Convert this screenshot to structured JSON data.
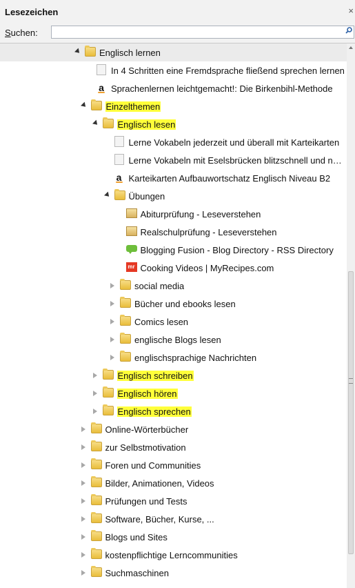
{
  "panel": {
    "title": "Lesezeichen",
    "close": "×"
  },
  "search": {
    "label_prefix": "S",
    "label_rest": "uchen:",
    "value": "",
    "placeholder": ""
  },
  "items": [
    {
      "label": "Englisch lernen",
      "icon": "folder-icon",
      "depth": 0,
      "expand": "open",
      "selected": true,
      "highlight": false
    },
    {
      "label": "In 4 Schritten eine Fremdsprache fließend sprechen lernen",
      "icon": "page-icon",
      "depth": 1,
      "expand": "none",
      "highlight": false
    },
    {
      "label": "Sprachenlernen leichtgemacht!: Die Birkenbihl-Methode",
      "icon": "amazon-icon",
      "depth": 1,
      "expand": "none",
      "highlight": false
    },
    {
      "label": "Einzelthemen",
      "icon": "folder-icon",
      "depth": 0.5,
      "expand": "open",
      "highlight": true
    },
    {
      "label": "Englisch lesen",
      "icon": "folder-icon",
      "depth": 1.5,
      "expand": "open",
      "highlight": true
    },
    {
      "label": "Lerne Vokabeln jederzeit und überall mit Karteikarten",
      "icon": "page-icon",
      "depth": 2.5,
      "expand": "none",
      "highlight": false
    },
    {
      "label": "Lerne Vokabeln mit Eselsbrücken blitzschnell und nachhaltig",
      "icon": "page-icon",
      "depth": 2.5,
      "expand": "none",
      "highlight": false
    },
    {
      "label": "Karteikarten Aufbauwortschatz Englisch Niveau B2",
      "icon": "amazon-icon",
      "depth": 2.5,
      "expand": "none",
      "highlight": false
    },
    {
      "label": "Übungen",
      "icon": "folder-icon",
      "depth": 2.5,
      "expand": "open",
      "highlight": false
    },
    {
      "label": "Abiturprüfung  - Leseverstehen",
      "icon": "certificate-icon",
      "depth": 3.5,
      "expand": "none",
      "highlight": false
    },
    {
      "label": "Realschulprüfung - Leseverstehen",
      "icon": "certificate-icon",
      "depth": 3.5,
      "expand": "none",
      "highlight": false
    },
    {
      "label": "Blogging Fusion - Blog Directory - RSS Directory",
      "icon": "chat-icon",
      "depth": 3.5,
      "expand": "none",
      "highlight": false
    },
    {
      "label": "Cooking Videos | MyRecipes.com",
      "icon": "myrecipes-icon",
      "depth": 3.5,
      "expand": "none",
      "highlight": false
    },
    {
      "label": "social media",
      "icon": "folder-icon",
      "depth": 3,
      "expand": "closed",
      "highlight": false
    },
    {
      "label": "Bücher und ebooks lesen",
      "icon": "folder-icon",
      "depth": 3,
      "expand": "closed",
      "highlight": false
    },
    {
      "label": "Comics lesen",
      "icon": "folder-icon",
      "depth": 3,
      "expand": "closed",
      "highlight": false
    },
    {
      "label": "englische Blogs lesen",
      "icon": "folder-icon",
      "depth": 3,
      "expand": "closed",
      "highlight": false
    },
    {
      "label": "englischsprachige Nachrichten",
      "icon": "folder-icon",
      "depth": 3,
      "expand": "closed",
      "highlight": false
    },
    {
      "label": "Englisch schreiben",
      "icon": "folder-icon",
      "depth": 1.5,
      "expand": "closed",
      "highlight": true
    },
    {
      "label": "Englisch hören",
      "icon": "folder-icon",
      "depth": 1.5,
      "expand": "closed",
      "highlight": true
    },
    {
      "label": "Englisch sprechen",
      "icon": "folder-icon",
      "depth": 1.5,
      "expand": "closed",
      "highlight": true
    },
    {
      "label": "Online-Wörterbücher",
      "icon": "folder-icon",
      "depth": 0.5,
      "expand": "closed",
      "highlight": false
    },
    {
      "label": "zur Selbstmotivation",
      "icon": "folder-icon",
      "depth": 0.5,
      "expand": "closed",
      "highlight": false
    },
    {
      "label": "Foren und Communities",
      "icon": "folder-icon",
      "depth": 0.5,
      "expand": "closed",
      "highlight": false
    },
    {
      "label": "Bilder, Animationen, Videos",
      "icon": "folder-icon",
      "depth": 0.5,
      "expand": "closed",
      "highlight": false
    },
    {
      "label": "Prüfungen und Tests",
      "icon": "folder-icon",
      "depth": 0.5,
      "expand": "closed",
      "highlight": false
    },
    {
      "label": "Software, Bücher, Kurse, ...",
      "icon": "folder-icon",
      "depth": 0.5,
      "expand": "closed",
      "highlight": false
    },
    {
      "label": "Blogs und Sites",
      "icon": "folder-icon",
      "depth": 0.5,
      "expand": "closed",
      "highlight": false
    },
    {
      "label": "kostenpflichtige Lerncommunities",
      "icon": "folder-icon",
      "depth": 0.5,
      "expand": "closed",
      "highlight": false
    },
    {
      "label": "Suchmaschinen",
      "icon": "folder-icon",
      "depth": 0.5,
      "expand": "closed",
      "highlight": false
    }
  ],
  "colors": {
    "highlight": "#ffff3a",
    "folder": "#e9bd3b",
    "selected_row": "#ebebeb"
  }
}
